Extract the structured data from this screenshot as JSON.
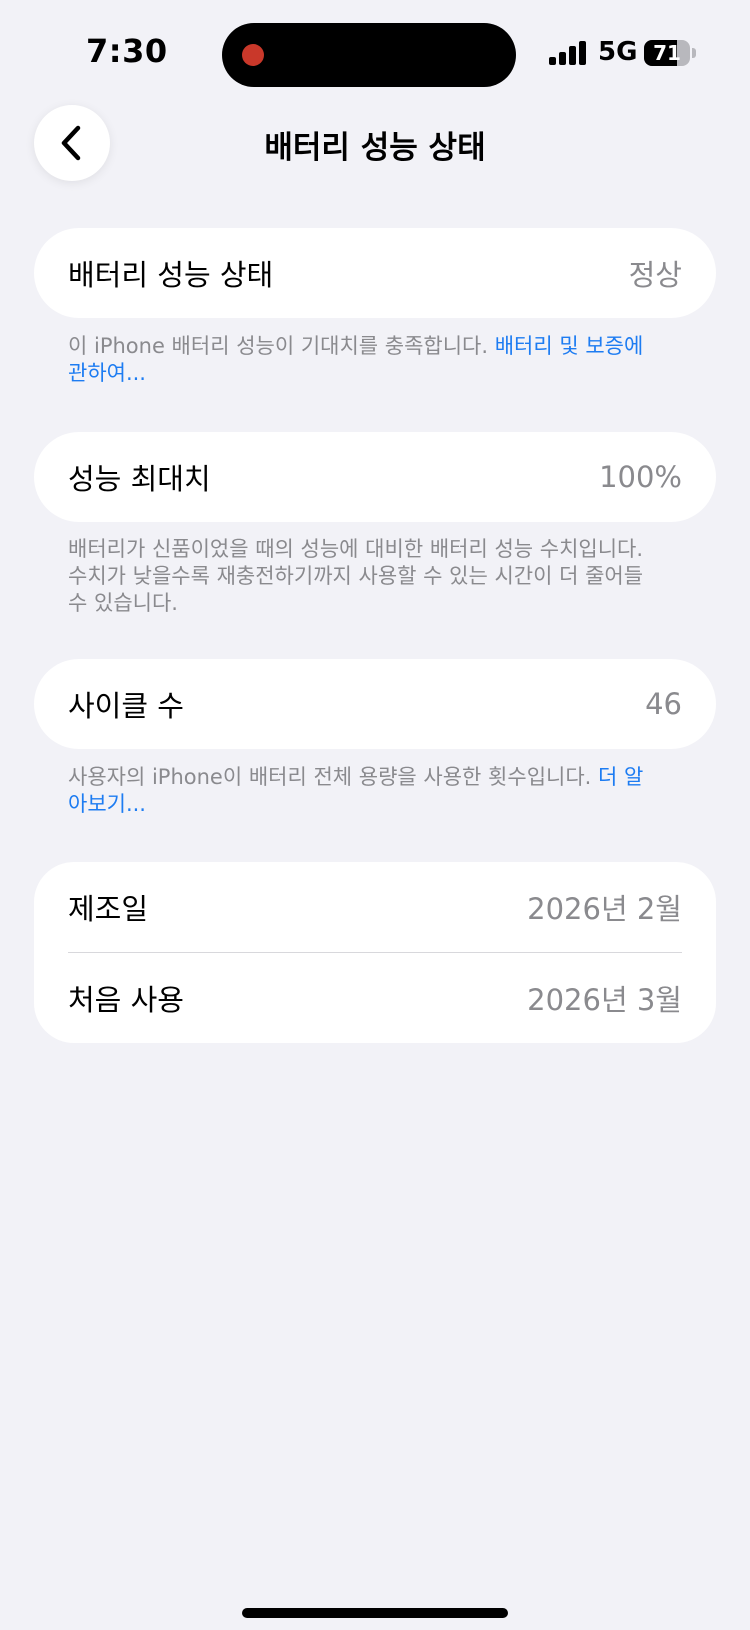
{
  "status_bar": {
    "time": "7:30",
    "network": "5G",
    "battery_level": "71",
    "battery_fraction": 0.71
  },
  "nav": {
    "title": "배터리 성능 상태",
    "back_icon": "chevron-left-icon"
  },
  "health": {
    "label": "배터리 성능 상태",
    "value": "정상",
    "footnote": "이 iPhone 배터리 성능이 기대치를 충족합니다. ",
    "link": "배터리 및 보증에 관하여..."
  },
  "max_capacity": {
    "label": "성능 최대치",
    "value": "100%",
    "footnote": "배터리가 신품이었을 때의 성능에 대비한 배터리 성능 수치입니다. 수치가 낮을수록 재충전하기까지 사용할 수 있는 시간이 더 줄어들 수 있습니다."
  },
  "cycle_count": {
    "label": "사이클 수",
    "value": "46",
    "footnote": "사용자의 iPhone이 배터리 전체 용량을 사용한 횟수입니다. ",
    "link": "더 알아보기..."
  },
  "dates": {
    "manufactured_label": "제조일",
    "manufactured_value": "2026년 2월",
    "first_use_label": "처음 사용",
    "first_use_value": "2026년 3월"
  },
  "colors": {
    "background": "#f2f2f7",
    "link": "#1d7cf2",
    "secondary_text": "#8a8a8e"
  }
}
